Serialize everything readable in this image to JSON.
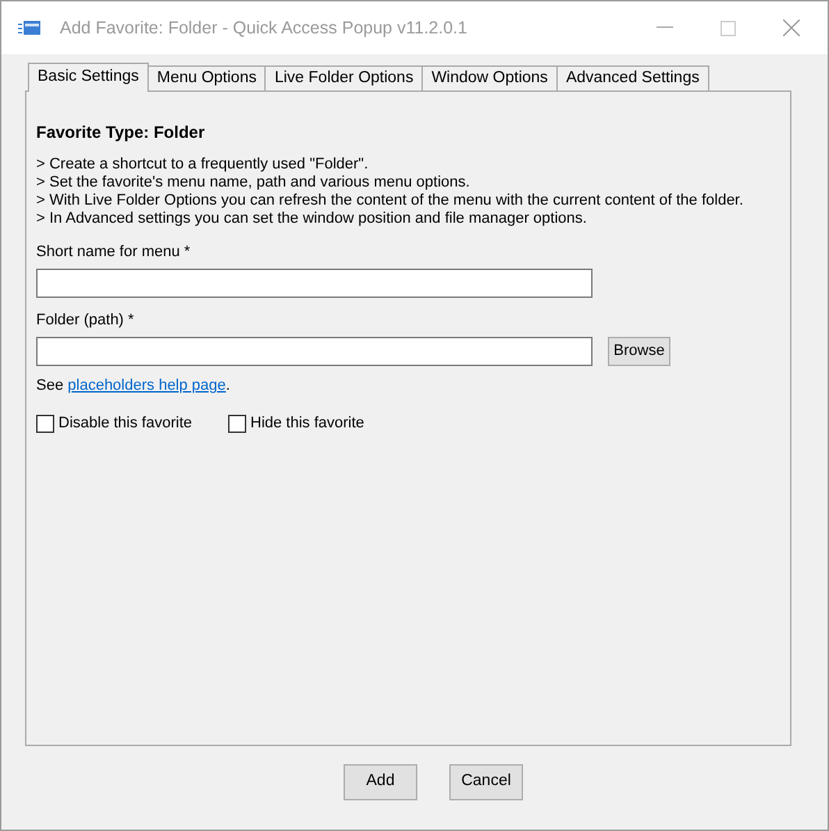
{
  "window": {
    "title": "Add Favorite: Folder - Quick Access Popup v11.2.0.1"
  },
  "tabs": [
    {
      "label": "Basic Settings",
      "selected": true
    },
    {
      "label": "Menu Options",
      "selected": false
    },
    {
      "label": "Live Folder Options",
      "selected": false
    },
    {
      "label": "Window Options",
      "selected": false
    },
    {
      "label": "Advanced Settings",
      "selected": false
    }
  ],
  "heading": "Favorite Type: Folder",
  "description": [
    "> Create a shortcut to a frequently used \"Folder\".",
    "> Set the favorite's menu name, path and various menu options.",
    "> With Live Folder Options you can refresh the content of the menu with the current content of the folder.",
    "> In Advanced settings you can set the window position and file manager options."
  ],
  "short_name": {
    "label": "Short name for menu *"
  },
  "folder": {
    "label": "Folder (path) *",
    "button": "Browse"
  },
  "help": {
    "prefix": "See ",
    "link": "placeholders help page",
    "suffix": "."
  },
  "options": [
    {
      "label": "Disable this favorite",
      "checked": false
    },
    {
      "label": "Hide this favorite",
      "checked": false
    }
  ],
  "buttons": [
    "Add",
    "Cancel"
  ]
}
